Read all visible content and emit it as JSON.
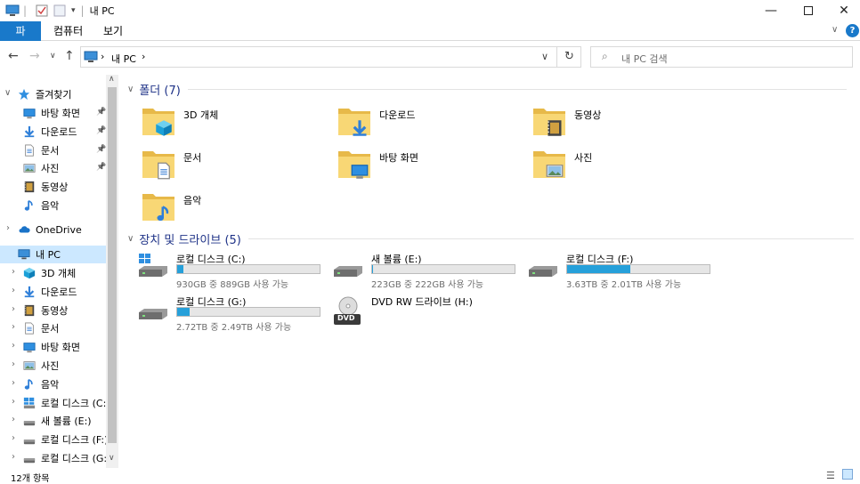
{
  "window": {
    "title": "내 PC",
    "separator": "|"
  },
  "ribbon": {
    "tabs": [
      {
        "label": "파일",
        "active": true
      },
      {
        "label": "컴퓨터",
        "active": false
      },
      {
        "label": "보기",
        "active": false
      }
    ]
  },
  "navbar": {
    "breadcrumb": [
      "내 PC"
    ],
    "search_placeholder": "내 PC 검색"
  },
  "sidebar": {
    "quick_access_label": "즐겨찾기",
    "quick_access_items": [
      {
        "label": "바탕 화면",
        "icon": "desktop-icon",
        "pinned": true
      },
      {
        "label": "다운로드",
        "icon": "download-icon",
        "pinned": true
      },
      {
        "label": "문서",
        "icon": "document-icon",
        "pinned": true
      },
      {
        "label": "사진",
        "icon": "pictures-icon",
        "pinned": true
      },
      {
        "label": "동영상",
        "icon": "video-icon",
        "pinned": false
      },
      {
        "label": "음악",
        "icon": "music-icon",
        "pinned": false
      }
    ],
    "onedrive_label": "OneDrive",
    "this_pc_label": "내 PC",
    "this_pc_items": [
      {
        "label": "3D 개체",
        "icon": "3d-objects-icon"
      },
      {
        "label": "다운로드",
        "icon": "download-icon"
      },
      {
        "label": "동영상",
        "icon": "video-icon"
      },
      {
        "label": "문서",
        "icon": "document-icon"
      },
      {
        "label": "바탕 화면",
        "icon": "desktop-icon"
      },
      {
        "label": "사진",
        "icon": "pictures-icon"
      },
      {
        "label": "음악",
        "icon": "music-icon"
      },
      {
        "label": "로컬 디스크 (C:)",
        "icon": "windows-drive-icon"
      },
      {
        "label": "새 볼륨 (E:)",
        "icon": "drive-icon"
      },
      {
        "label": "로컬 디스크 (F:)",
        "icon": "drive-icon"
      },
      {
        "label": "로컬 디스크 (G:)",
        "icon": "drive-icon"
      }
    ]
  },
  "content": {
    "folders_header": "폴더 (7)",
    "folders": [
      {
        "label": "3D 개체",
        "icon": "3d-objects-icon"
      },
      {
        "label": "다운로드",
        "icon": "download-icon"
      },
      {
        "label": "동영상",
        "icon": "video-icon"
      },
      {
        "label": "문서",
        "icon": "document-icon"
      },
      {
        "label": "바탕 화면",
        "icon": "desktop-icon"
      },
      {
        "label": "사진",
        "icon": "pictures-icon"
      },
      {
        "label": "음악",
        "icon": "music-icon"
      }
    ],
    "drives_header": "장치 및 드라이브 (5)",
    "drives": [
      {
        "label": "로컬 디스크 (C:)",
        "free_text": "930GB 중 889GB 사용 가능",
        "used_fraction": 0.044,
        "icon": "windows-drive-icon"
      },
      {
        "label": "새 볼륨 (E:)",
        "free_text": "223GB 중 222GB 사용 가능",
        "used_fraction": 0.004,
        "icon": "drive-icon"
      },
      {
        "label": "로컬 디스크 (F:)",
        "free_text": "3.63TB 중 2.01TB 사용 가능",
        "used_fraction": 0.446,
        "icon": "drive-icon"
      },
      {
        "label": "로컬 디스크 (G:)",
        "free_text": "2.72TB 중 2.49TB 사용 가능",
        "used_fraction": 0.085,
        "icon": "drive-icon"
      },
      {
        "label": "DVD RW 드라이브 (H:)",
        "free_text": "",
        "used_fraction": null,
        "icon": "dvd-icon",
        "badge": "DVD"
      }
    ]
  },
  "status": {
    "item_count": "12개 항목"
  },
  "colors": {
    "accent": "#1979ca",
    "section_header": "#1e3287",
    "selected": "#cce8ff",
    "bar_fill": "#26a0da",
    "folder": "#f8d775"
  }
}
